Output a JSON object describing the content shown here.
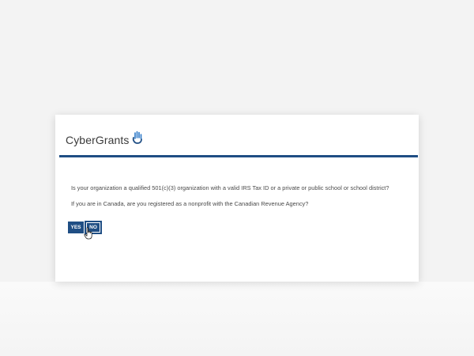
{
  "brand": {
    "name": "CyberGrants",
    "accent_color": "#1f4e84",
    "icon": "hand-wave-icon"
  },
  "form": {
    "question_1": "Is your organization a qualified 501(c)(3) organization with a valid IRS Tax ID or a private or public school or school district?",
    "question_2": "If you are in Canada, are you registered as a nonprofit with the Canadian Revenue Agency?",
    "yes_label": "YES",
    "no_label": "NO"
  },
  "cursor": {
    "icon": "hand-pointer-icon"
  }
}
